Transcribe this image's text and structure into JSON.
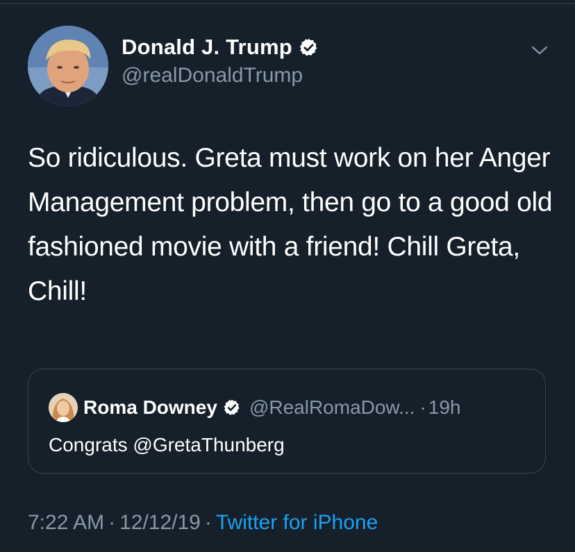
{
  "tweet": {
    "author": {
      "name": "Donald J. Trump",
      "handle": "@realDonaldTrump",
      "verified": true
    },
    "text": "So ridiculous. Greta must work on her Anger Management problem, then go to a good old fashioned movie with a friend! Chill Greta, Chill!",
    "quoted_tweet": {
      "author_name": "Roma Downey",
      "author_handle": "@RealRomaDow...",
      "separator": "·",
      "time_ago": "19h",
      "verified": true,
      "text": "Congrats @GretaThunberg"
    },
    "meta": {
      "time": "7:22 AM",
      "separator1": "·",
      "date": "12/12/19",
      "separator2": "·",
      "source": "Twitter for iPhone"
    }
  },
  "icons": {
    "verified": "verified-badge-icon",
    "more": "chevron-down-icon"
  },
  "colors": {
    "background": "#15202b",
    "text_primary": "#ffffff",
    "text_secondary": "#8899a6",
    "accent": "#1da1f2",
    "border": "#38444d"
  }
}
